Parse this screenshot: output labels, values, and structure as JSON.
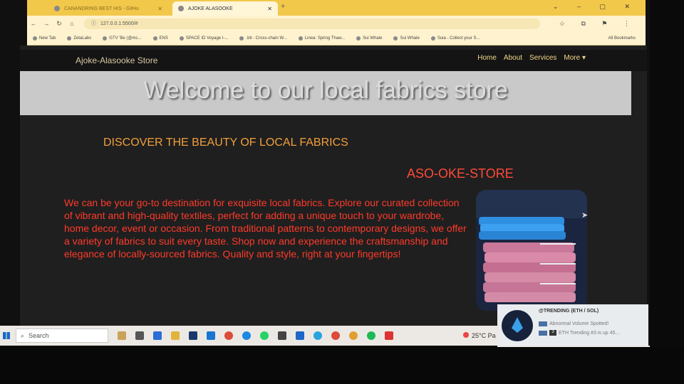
{
  "browser": {
    "tabs": [
      {
        "label": "CANANDRING BEST HIS - GitHu"
      },
      {
        "label": "AJOKE ALASOOKE"
      }
    ],
    "new_tab": "+",
    "url": "127.0.0.1:5500/#",
    "bookmarks": [
      "New Tab",
      "ZetaLabs",
      "GTV 'Be (@mc...",
      "ENS",
      "SPACE ID Voyage I-...",
      ".bit - Cross-chain W...",
      "Linea: Spring Thaw...",
      "Sui Whale",
      "Sui Whale",
      "Suia - Collect your S..."
    ],
    "all_bookmarks": "All Bookmarks"
  },
  "site": {
    "brand": "Ajoke-Alasooke Store",
    "nav": [
      "Home",
      "About",
      "Services",
      "More ▾"
    ],
    "hero_title": "Welcome to our local fabrics store",
    "discover": "DISCOVER THE BEAUTY OF LOCAL FABRICS",
    "store_name": "ASO-OKE-STORE",
    "description": "We can be your go-to destination for exquisite local fabrics. Explore our curated collection of vibrant and high-quality textiles, perfect for adding a unique touch to your wardrobe, home decor, event or occasion. From traditional patterns to contemporary designs, we offer a variety of fabrics to suit every taste. Shop now and experience the craftsmanship and elegance of locally-sourced fabrics. Quality and style, right at your fingertips!"
  },
  "toast": {
    "heading": "@TRENDING (ETH / SOL)",
    "line1": "Abnormal Volume Spotted!",
    "line2_num": "3",
    "line2": "ETH Trending #3 is up 45..."
  },
  "taskbar": {
    "search": "Search",
    "weather": "25°C  Pa"
  },
  "colors": {
    "accent_orange": "#f2a03a",
    "accent_red": "#ff3a2a",
    "tabstrip": "#f2c84b"
  }
}
